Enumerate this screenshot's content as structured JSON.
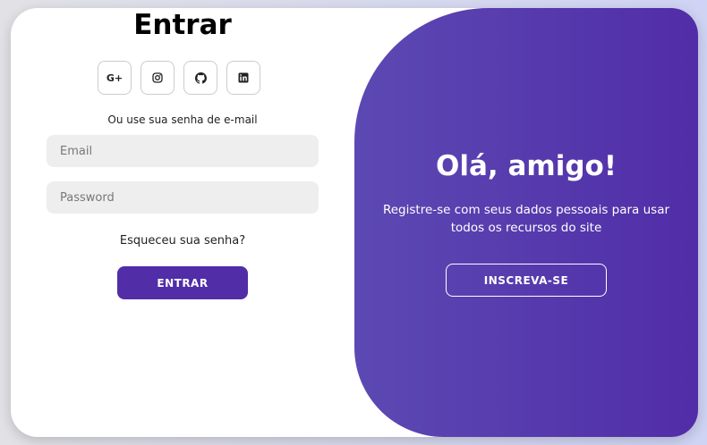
{
  "colors": {
    "accent": "#512da8",
    "panel_gradient_start": "#5c49b3",
    "panel_gradient_end": "#512da8",
    "input_background": "#eeeeee"
  },
  "signin": {
    "title": "Entrar",
    "social_icons": [
      "google-plus-icon",
      "instagram-icon",
      "github-icon",
      "linkedin-icon"
    ],
    "google_label": "G+",
    "hint": "Ou use sua senha de e-mail",
    "email_placeholder": "Email",
    "email_value": "",
    "password_placeholder": "Password",
    "password_value": "",
    "forgot_link": "Esqueceu sua senha?",
    "submit_label": "ENTRAR"
  },
  "panel": {
    "title": "Olá, amigo!",
    "text": "Registre-se com seus dados pessoais para usar todos os recursos do site",
    "signup_label": "INSCREVA-SE"
  }
}
